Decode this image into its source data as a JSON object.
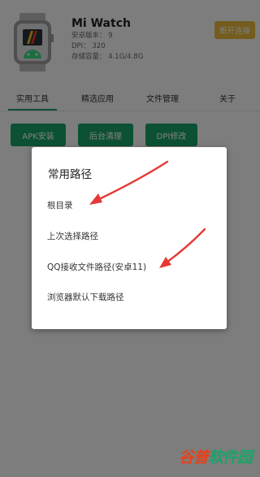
{
  "device": {
    "name": "Mi Watch",
    "android_version": "安卓版本： 9",
    "dpi": "DPI： 320",
    "storage": "存储容量： 4.1G/4.8G",
    "disconnect_label": "断开连接"
  },
  "tabs": [
    {
      "label": "实用工具",
      "active": true
    },
    {
      "label": "精选应用",
      "active": false
    },
    {
      "label": "文件管理",
      "active": false
    },
    {
      "label": "关于",
      "active": false
    }
  ],
  "tools": [
    {
      "label": "APK安装"
    },
    {
      "label": "后台清理"
    },
    {
      "label": "DPI修改"
    }
  ],
  "dialog": {
    "title": "常用路径",
    "items": [
      {
        "label": "根目录"
      },
      {
        "label": "上次选择路径"
      },
      {
        "label": "QQ接收文件路径(安卓11)"
      },
      {
        "label": "浏览器默认下载路径"
      }
    ]
  },
  "watermark": {
    "part_red": "谷普",
    "part_green": "软件园"
  },
  "colors": {
    "accent_green": "#1aa368",
    "disconnect_yellow": "#e7b93a",
    "arrow_red": "#e53935"
  }
}
